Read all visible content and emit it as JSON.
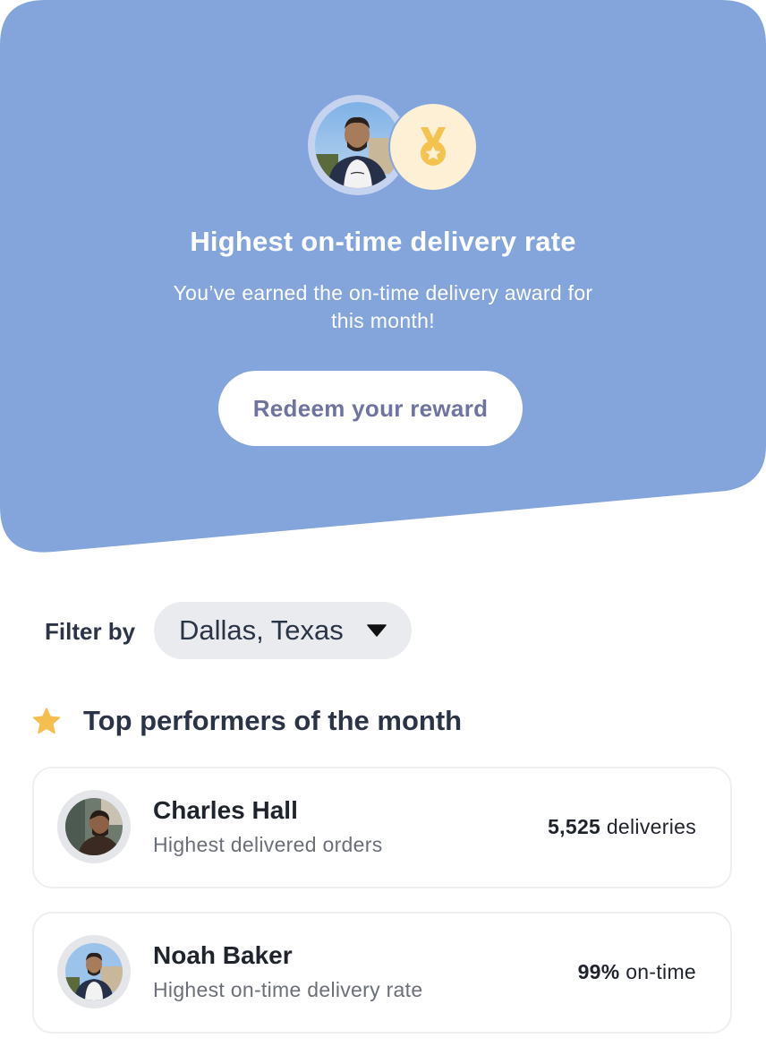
{
  "hero": {
    "title": "Highest on-time delivery rate",
    "subtitle": "You’ve earned the on-time delivery award for this month!",
    "redeem_label": "Redeem your reward",
    "background_color": "#83a5dc",
    "medal_color": "#f4c24f"
  },
  "filter": {
    "label": "Filter by",
    "selected": "Dallas, Texas"
  },
  "top_performers": {
    "title": "Top performers of the month",
    "star_color": "#f5bf4f",
    "items": [
      {
        "name": "Charles Hall",
        "description": "Highest delivered orders",
        "stat_value": "5,525",
        "stat_unit": "deliveries"
      },
      {
        "name": "Noah Baker",
        "description": "Highest on-time delivery rate",
        "stat_value": "99%",
        "stat_unit": "on-time"
      }
    ]
  }
}
